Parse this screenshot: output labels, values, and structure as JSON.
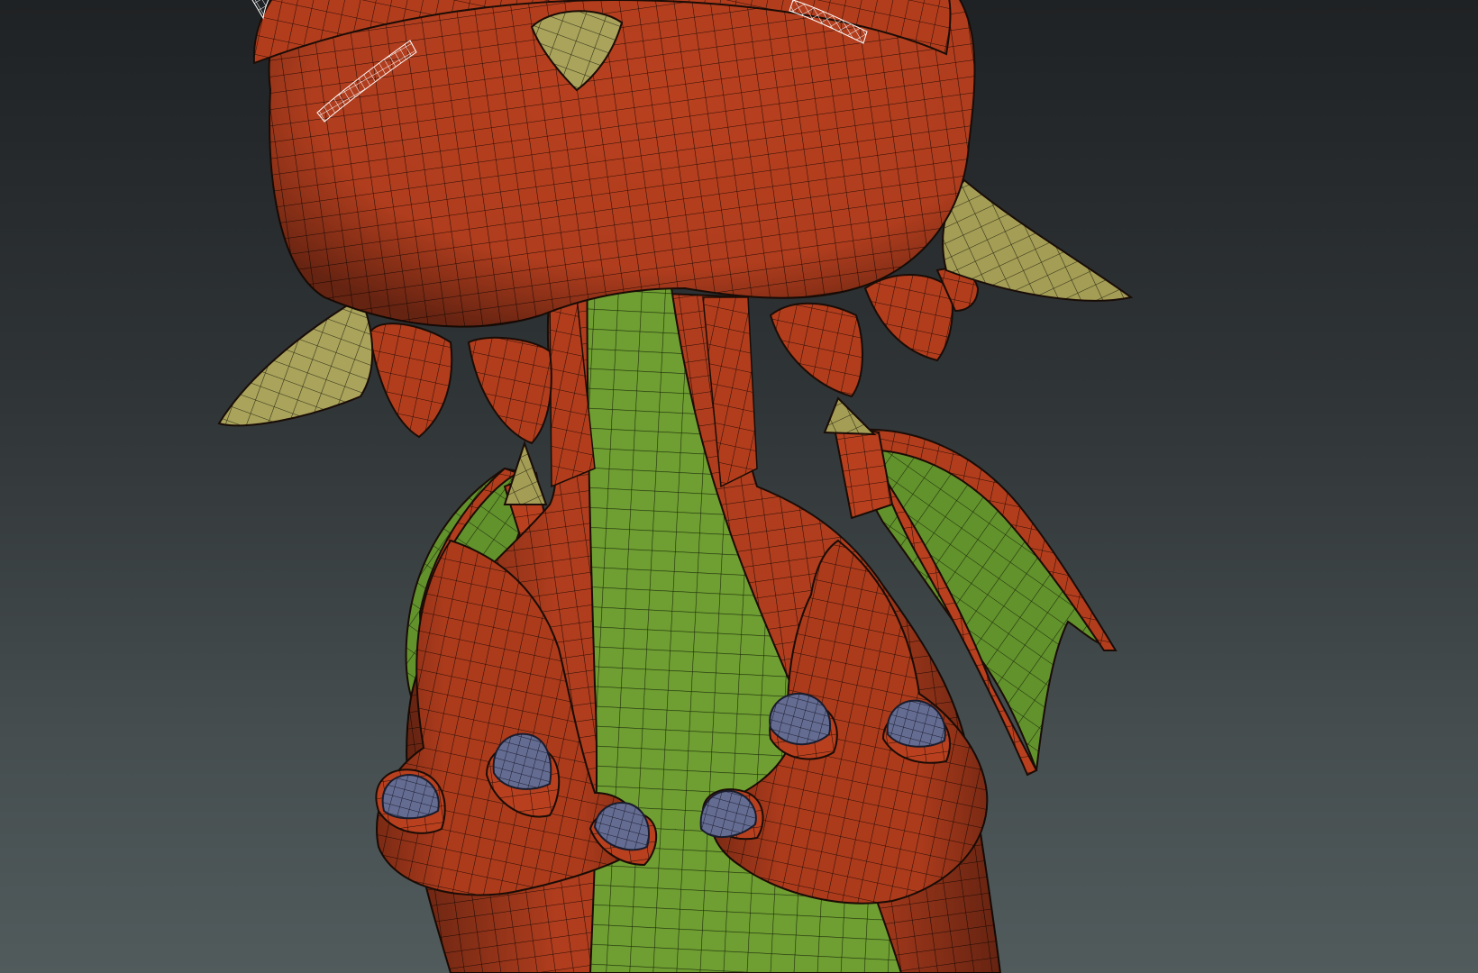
{
  "viewport": {
    "kind": "3d-viewport",
    "shading": "wireframe-on-shaded"
  },
  "model": {
    "subject": "cartoon-dragon",
    "materials": {
      "skin": "#b8401f",
      "belly": "#6f9f32",
      "horns": "#a9a35c",
      "claws": "#646c92",
      "wireframe": "#1a0c06",
      "selection": "#ffffff"
    }
  }
}
